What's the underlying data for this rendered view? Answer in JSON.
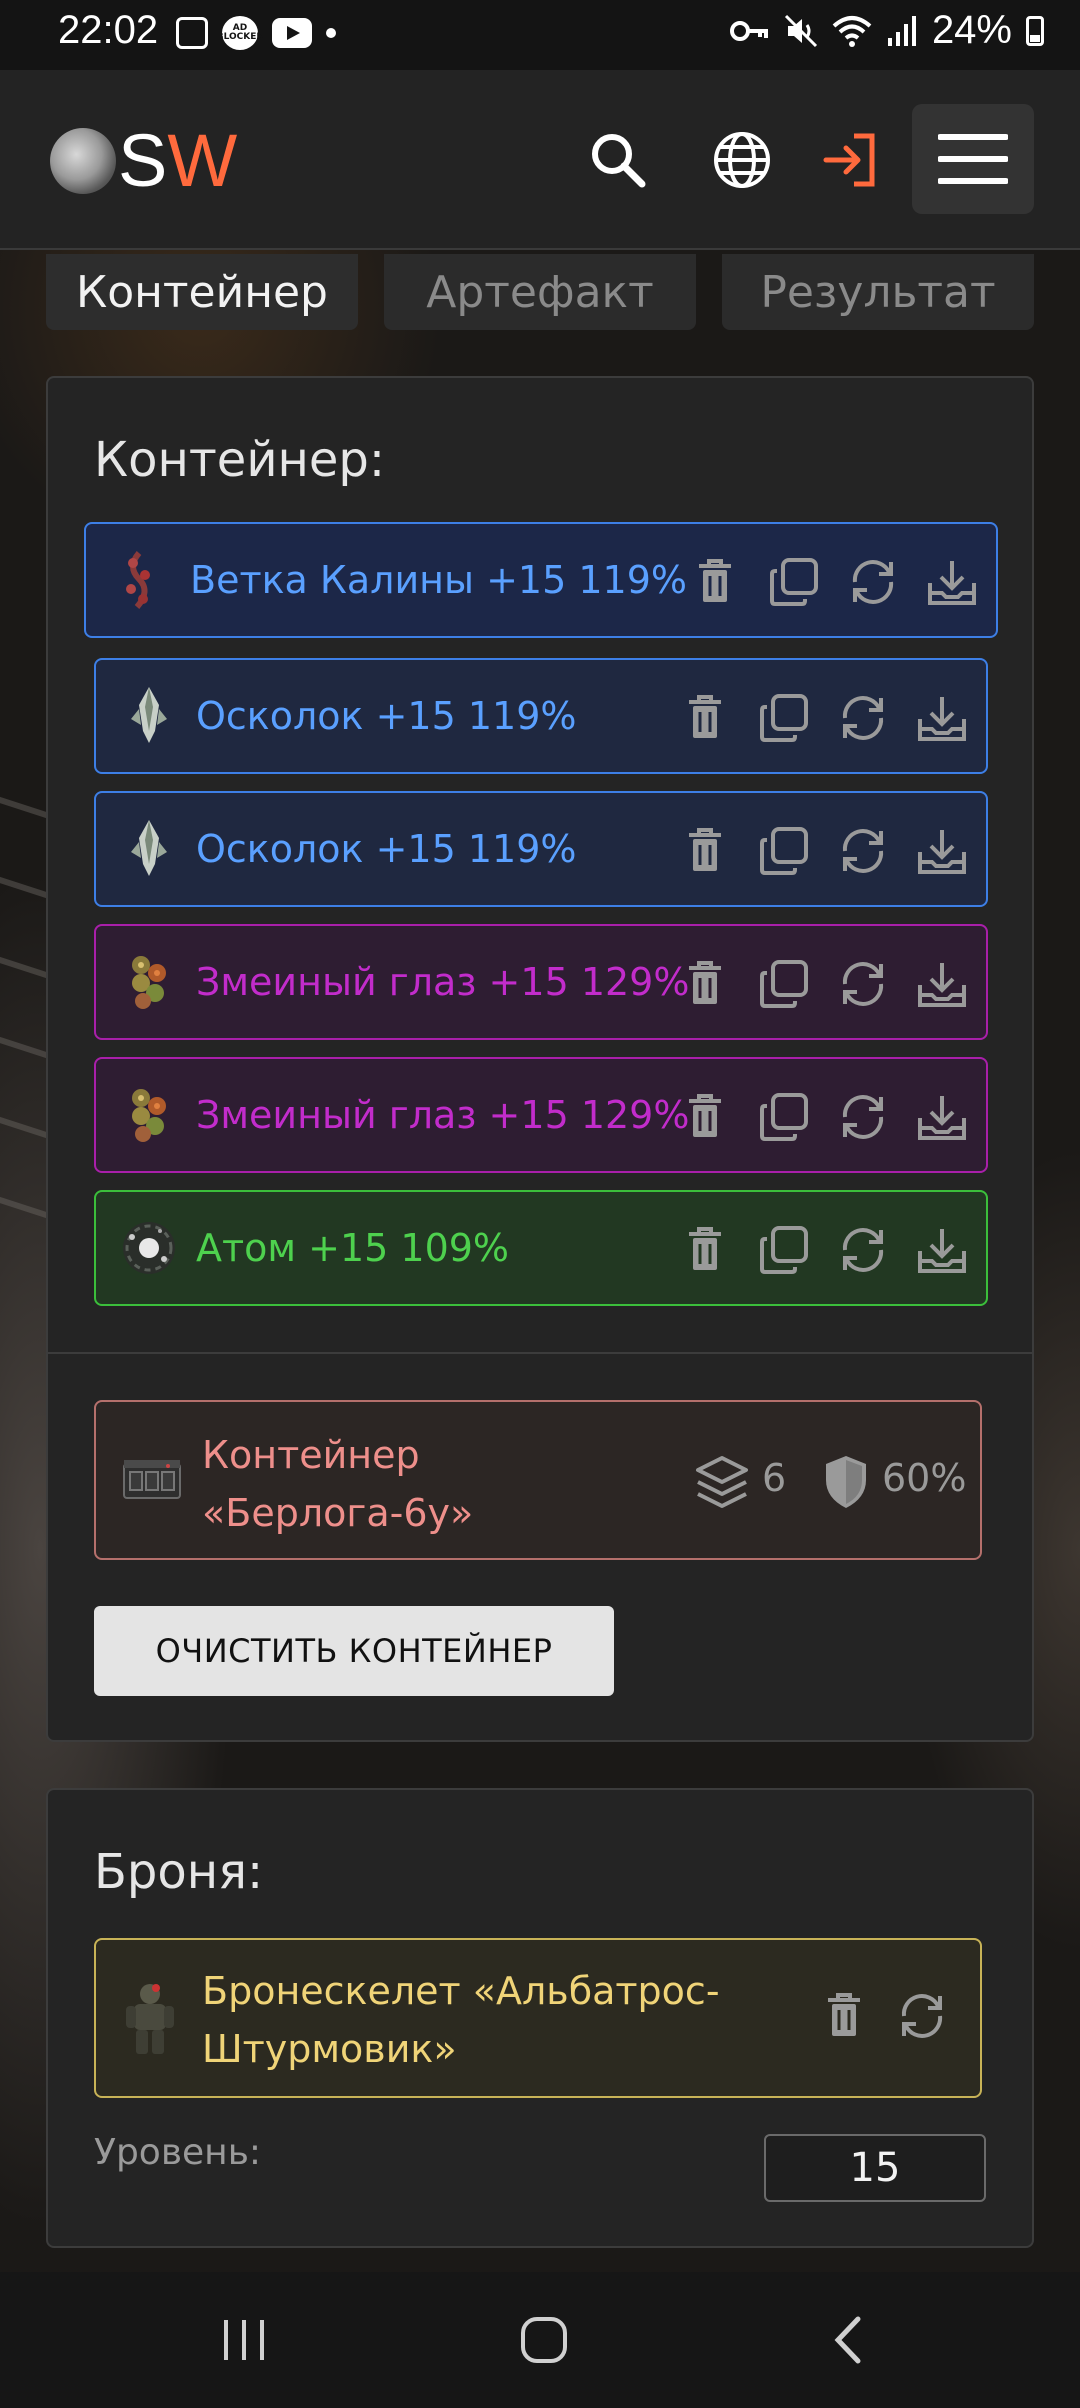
{
  "status_bar": {
    "time": "22:02",
    "adblock": "AD BLOCKER",
    "battery": "24%"
  },
  "header": {
    "logo_s": "S",
    "logo_w": "W"
  },
  "tabs": [
    {
      "label": "Контейнер",
      "active": true
    },
    {
      "label": "Артефакт",
      "active": false
    },
    {
      "label": "Результат",
      "active": false
    }
  ],
  "container_card": {
    "title": "Контейнер:",
    "artifacts": [
      {
        "label": "Ветка Калины +15 119%",
        "rarity": "blue",
        "icon": "branch-artifact-icon"
      },
      {
        "label": "Осколок +15 119%",
        "rarity": "blue",
        "icon": "shard-artifact-icon"
      },
      {
        "label": "Осколок +15 119%",
        "rarity": "blue",
        "icon": "shard-artifact-icon"
      },
      {
        "label": "Змеиный глаз +15 129%",
        "rarity": "purple",
        "icon": "snake-eye-artifact-icon"
      },
      {
        "label": "Змеиный глаз +15 129%",
        "rarity": "purple",
        "icon": "snake-eye-artifact-icon"
      },
      {
        "label": "Атом +15 109%",
        "rarity": "green",
        "icon": "atom-artifact-icon"
      }
    ],
    "container": {
      "name_line1": "Контейнер",
      "name_line2": "«Берлога-6у»",
      "slots": "6",
      "protection": "60%"
    },
    "clear_button": "ОЧИСТИТЬ КОНТЕЙНЕР"
  },
  "armor_card": {
    "title": "Броня:",
    "armor_line1": "Бронескелет «Альбатрос-",
    "armor_line2": "Штурмовик»",
    "level_label": "Уровень:",
    "level_value": "15"
  },
  "colors": {
    "accent": "#ff6a3d",
    "blue": "#5aa0ff",
    "purple": "#c22ccb",
    "green": "#4ed14e",
    "container": "#ee8f8b",
    "armor": "#f0d478"
  }
}
